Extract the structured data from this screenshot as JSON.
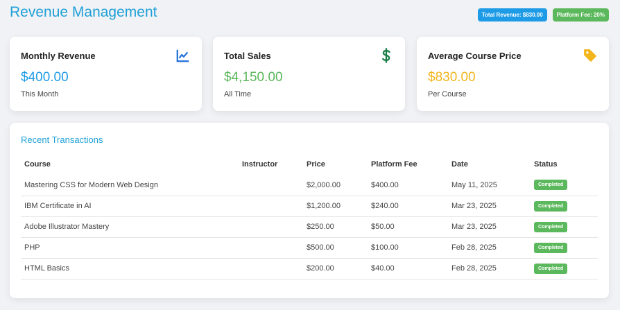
{
  "header": {
    "title": "Revenue Management",
    "badge_total_revenue": "Total Revenue: $830.00",
    "badge_platform_fee": "Platform Fee: 20%"
  },
  "cards": [
    {
      "title": "Monthly Revenue",
      "value": "$400.00",
      "sub": "This Month",
      "icon": "line-chart-icon",
      "color": "#1e9be6"
    },
    {
      "title": "Total Sales",
      "value": "$4,150.00",
      "sub": "All Time",
      "icon": "dollar-icon",
      "color": "#5cb85c"
    },
    {
      "title": "Average Course Price",
      "value": "$830.00",
      "sub": "Per Course",
      "icon": "tag-icon",
      "color": "#f2b51c"
    }
  ],
  "transactions": {
    "title": "Recent Transactions",
    "columns": [
      "Course",
      "Instructor",
      "Price",
      "Platform Fee",
      "Date",
      "Status"
    ],
    "rows": [
      {
        "course": "Mastering CSS for Modern Web Design",
        "instructor": "",
        "price": "$2,000.00",
        "fee": "$400.00",
        "date": "May 11, 2025",
        "status": "Completed"
      },
      {
        "course": "IBM Certificate in AI",
        "instructor": "",
        "price": "$1,200.00",
        "fee": "$240.00",
        "date": "Mar 23, 2025",
        "status": "Completed"
      },
      {
        "course": "Adobe Illustrator Mastery",
        "instructor": "",
        "price": "$250.00",
        "fee": "$50.00",
        "date": "Mar 23, 2025",
        "status": "Completed"
      },
      {
        "course": "PHP",
        "instructor": "",
        "price": "$500.00",
        "fee": "$100.00",
        "date": "Feb 28, 2025",
        "status": "Completed"
      },
      {
        "course": "HTML Basics",
        "instructor": "",
        "price": "$200.00",
        "fee": "$40.00",
        "date": "Feb 28, 2025",
        "status": "Completed"
      }
    ]
  }
}
